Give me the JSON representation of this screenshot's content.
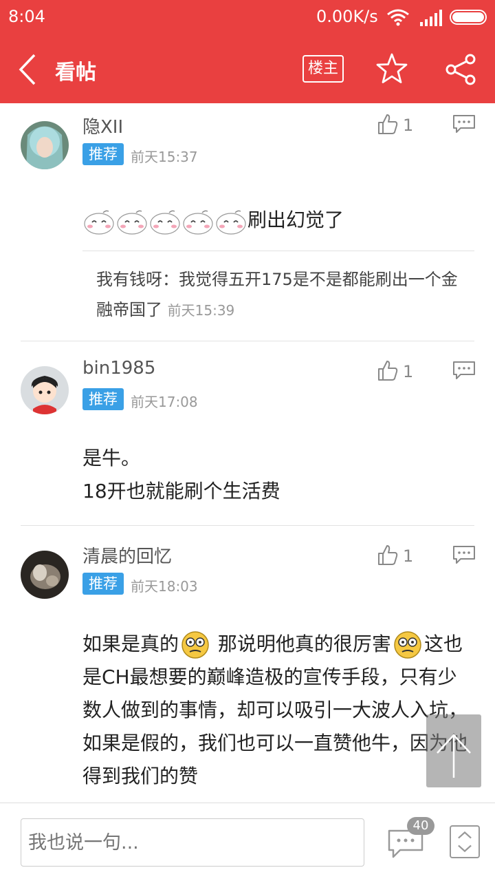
{
  "status_bar": {
    "time": "8:04",
    "speed": "0.00K/s"
  },
  "header": {
    "title": "看帖",
    "owner_label": "楼主"
  },
  "posts": [
    {
      "username": "隐XII",
      "tag": "推荐",
      "time": "前天15:37",
      "likes": "1",
      "content": "刷出幻觉了",
      "emoji_count": 5,
      "reply": {
        "author": "我有钱呀：",
        "text": "我觉得五开175是不是都能刷出一个金融帝国了",
        "time": "前天15:39"
      }
    },
    {
      "username": "bin1985",
      "tag": "推荐",
      "time": "前天17:08",
      "likes": "1",
      "content_line1": "是牛。",
      "content_line2": "18开也就能刷个生活费"
    },
    {
      "username": "清晨的回忆",
      "tag": "推荐",
      "time": "前天18:03",
      "likes": "1",
      "content_part1": "如果是真的",
      "content_part2": "那说明他真的很厉害",
      "content_rest": "这也是CH最想要的巅峰造极的宣传手段，只有少数人做到的事情，却可以吸引一大波人入坑，如果是假的，我们也可以一直赞他牛，因为他得到我们的赞"
    }
  ],
  "bottom_bar": {
    "input_placeholder": "我也说一句...",
    "comment_count": "40"
  },
  "colors": {
    "brand": "#e94040",
    "tag": "#3aa0e6"
  }
}
